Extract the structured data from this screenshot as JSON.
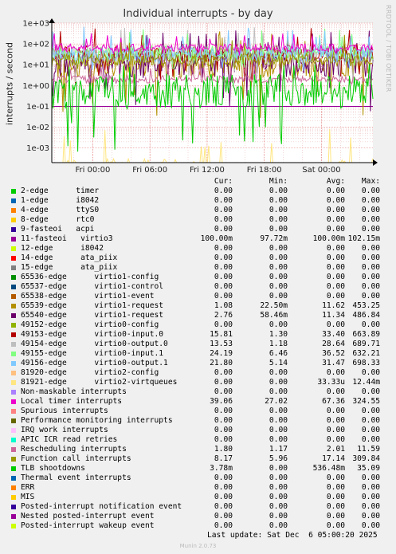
{
  "chart_data": {
    "type": "line",
    "title": "Individual interrupts - by day",
    "ylabel": "interrupts / second",
    "yscale": "log",
    "ylim": [
      0.0002,
      1000
    ],
    "yticks": [
      "1e+03",
      "1e+02",
      "1e+01",
      "1e+00",
      "1e-01",
      "1e-02",
      "1e-03"
    ],
    "ytick_values": [
      1000,
      100,
      10,
      1,
      0.1,
      0.01,
      0.001
    ],
    "xticks": [
      "Fri 00:00",
      "Fri 06:00",
      "Fri 12:00",
      "Fri 18:00",
      "Sat 00:00"
    ],
    "xtick_hours": [
      0,
      6,
      12,
      18,
      24
    ],
    "xlim_hours": [
      -4.3,
      29.4
    ],
    "grid": true,
    "columns": [
      "Cur:",
      "Min:",
      "Avg:",
      "Max:"
    ],
    "series": [
      {
        "name": "2-edge      timer",
        "color": "#00cc00",
        "cur": "0.00",
        "min": "0.00",
        "avg": "0.00",
        "max": "0.00"
      },
      {
        "name": "1-edge      i8042",
        "color": "#0066b3",
        "cur": "0.00",
        "min": "0.00",
        "avg": "0.00",
        "max": "0.00"
      },
      {
        "name": "4-edge      ttyS0",
        "color": "#ff8000",
        "cur": "0.00",
        "min": "0.00",
        "avg": "0.00",
        "max": "0.00"
      },
      {
        "name": "8-edge      rtc0",
        "color": "#ffcc00",
        "cur": "0.00",
        "min": "0.00",
        "avg": "0.00",
        "max": "0.00"
      },
      {
        "name": "9-fasteoi   acpi",
        "color": "#330099",
        "cur": "0.00",
        "min": "0.00",
        "avg": "0.00",
        "max": "0.00"
      },
      {
        "name": "11-fasteoi   virtio3",
        "color": "#990099",
        "cur": "100.00m",
        "min": "97.72m",
        "avg": "100.00m",
        "max": "102.15m"
      },
      {
        "name": "12-edge      i8042",
        "color": "#ccff00",
        "cur": "0.00",
        "min": "0.00",
        "avg": "0.00",
        "max": "0.00"
      },
      {
        "name": "14-edge      ata_piix",
        "color": "#ff0000",
        "cur": "0.00",
        "min": "0.00",
        "avg": "0.00",
        "max": "0.00"
      },
      {
        "name": "15-edge      ata_piix",
        "color": "#808080",
        "cur": "0.00",
        "min": "0.00",
        "avg": "0.00",
        "max": "0.00"
      },
      {
        "name": "65536-edge      virtio1-config",
        "color": "#008f00",
        "cur": "0.00",
        "min": "0.00",
        "avg": "0.00",
        "max": "0.00"
      },
      {
        "name": "65537-edge      virtio1-control",
        "color": "#00487d",
        "cur": "0.00",
        "min": "0.00",
        "avg": "0.00",
        "max": "0.00"
      },
      {
        "name": "65538-edge      virtio1-event",
        "color": "#b35a00",
        "cur": "0.00",
        "min": "0.00",
        "avg": "0.00",
        "max": "0.00"
      },
      {
        "name": "65539-edge      virtio1-request",
        "color": "#b38f00",
        "cur": "1.08",
        "min": "22.50m",
        "avg": "11.62",
        "max": "453.25"
      },
      {
        "name": "65540-edge      virtio1-request",
        "color": "#6b006b",
        "cur": "2.76",
        "min": "58.46m",
        "avg": "11.34",
        "max": "486.84"
      },
      {
        "name": "49152-edge      virtio0-config",
        "color": "#8fb300",
        "cur": "0.00",
        "min": "0.00",
        "avg": "0.00",
        "max": "0.00"
      },
      {
        "name": "49153-edge      virtio0-input.0",
        "color": "#b30000",
        "cur": "15.81",
        "min": "1.30",
        "avg": "33.40",
        "max": "663.89"
      },
      {
        "name": "49154-edge      virtio0-output.0",
        "color": "#bebebe",
        "cur": "13.53",
        "min": "1.18",
        "avg": "28.64",
        "max": "689.71"
      },
      {
        "name": "49155-edge      virtio0-input.1",
        "color": "#80ff80",
        "cur": "24.19",
        "min": "6.46",
        "avg": "36.52",
        "max": "632.21"
      },
      {
        "name": "49156-edge      virtio0-output.1",
        "color": "#80c9ff",
        "cur": "21.80",
        "min": "5.14",
        "avg": "31.47",
        "max": "698.33"
      },
      {
        "name": "81920-edge      virtio2-config",
        "color": "#ffc080",
        "cur": "0.00",
        "min": "0.00",
        "avg": "0.00",
        "max": "0.00"
      },
      {
        "name": "81921-edge      virtio2-virtqueues",
        "color": "#ffe680",
        "cur": "0.00",
        "min": "0.00",
        "avg": "33.33u",
        "max": "12.44m"
      },
      {
        "name": "Non-maskable interrupts",
        "color": "#aa80ff",
        "cur": "0.00",
        "min": "0.00",
        "avg": "0.00",
        "max": "0.00"
      },
      {
        "name": "Local timer interrupts",
        "color": "#ee00cc",
        "cur": "39.06",
        "min": "27.02",
        "avg": "67.36",
        "max": "324.55"
      },
      {
        "name": "Spurious interrupts",
        "color": "#ff8080",
        "cur": "0.00",
        "min": "0.00",
        "avg": "0.00",
        "max": "0.00"
      },
      {
        "name": "Performance monitoring interrupts",
        "color": "#666600",
        "cur": "0.00",
        "min": "0.00",
        "avg": "0.00",
        "max": "0.00"
      },
      {
        "name": "IRQ work interrupts",
        "color": "#ffbfff",
        "cur": "0.00",
        "min": "0.00",
        "avg": "0.00",
        "max": "0.00"
      },
      {
        "name": "APIC ICR read retries",
        "color": "#00ffcc",
        "cur": "0.00",
        "min": "0.00",
        "avg": "0.00",
        "max": "0.00"
      },
      {
        "name": "Rescheduling interrupts",
        "color": "#cc6699",
        "cur": "1.80",
        "min": "1.17",
        "avg": "2.01",
        "max": "11.59"
      },
      {
        "name": "Function call interrupts",
        "color": "#999900",
        "cur": "8.17",
        "min": "5.96",
        "avg": "17.14",
        "max": "309.84"
      },
      {
        "name": "TLB shootdowns",
        "color": "#00cc00",
        "cur": "3.78m",
        "min": "0.00",
        "avg": "536.48m",
        "max": "35.09"
      },
      {
        "name": "Thermal event interrupts",
        "color": "#0066b3",
        "cur": "0.00",
        "min": "0.00",
        "avg": "0.00",
        "max": "0.00"
      },
      {
        "name": "ERR",
        "color": "#ff8000",
        "cur": "0.00",
        "min": "0.00",
        "avg": "0.00",
        "max": "0.00"
      },
      {
        "name": "MIS",
        "color": "#ffcc00",
        "cur": "0.00",
        "min": "0.00",
        "avg": "0.00",
        "max": "0.00"
      },
      {
        "name": "Posted-interrupt notification event",
        "color": "#330099",
        "cur": "0.00",
        "min": "0.00",
        "avg": "0.00",
        "max": "0.00"
      },
      {
        "name": "Nested posted-interrupt event",
        "color": "#990099",
        "cur": "0.00",
        "min": "0.00",
        "avg": "0.00",
        "max": "0.00"
      },
      {
        "name": "Posted-interrupt wakeup event",
        "color": "#ccff00",
        "cur": "0.00",
        "min": "0.00",
        "avg": "0.00",
        "max": "0.00"
      }
    ]
  },
  "last_update": "Last update: Sat Dec  6 05:00:20 2025",
  "side_label": "RRDTOOL / TOBI OETIKER",
  "footer": "Munin 2.0.73"
}
